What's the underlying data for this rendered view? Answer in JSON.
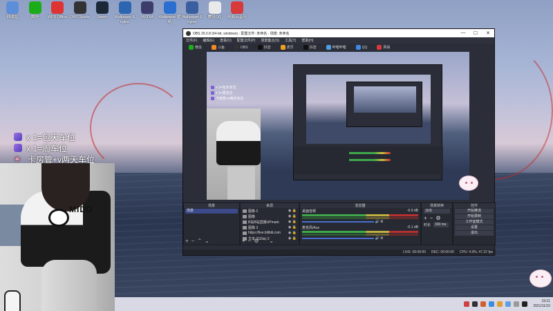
{
  "desktop": {
    "icons": [
      {
        "label": "回收站",
        "color": "#5d8fd8",
        "icon": "recycle-bin-icon"
      },
      {
        "label": "微信",
        "color": "#1aad19",
        "icon": "wechat-icon"
      },
      {
        "label": "WPS Office",
        "color": "#d33",
        "icon": "wps-icon"
      },
      {
        "label": "OBS Studio",
        "color": "#333",
        "icon": "obs-icon"
      },
      {
        "label": "Steam",
        "color": "#1b2838",
        "icon": "steam-icon"
      },
      {
        "label": "Wallpaper Engine",
        "color": "#2c66b0",
        "icon": "wallpaper-icon"
      },
      {
        "label": "NVIDIA",
        "color": "#3d3d6b",
        "icon": "app-icon"
      },
      {
        "label": "Wallpaper 壁纸",
        "color": "#2a6fd0",
        "icon": "wallpaper-icon"
      },
      {
        "label": "Wallpaper Engine",
        "color": "#3a5fa0",
        "icon": "wallpaper-icon"
      },
      {
        "label": "腾讯QQ",
        "color": "#e9e9e9",
        "icon": "qq-icon"
      },
      {
        "label": "网易云音乐",
        "color": "#d63a3a",
        "icon": "music-icon"
      }
    ]
  },
  "overlay": {
    "lines": [
      "x 1=包天车位",
      "x 1=周车位",
      "卡房管+v两天车位"
    ]
  },
  "camera": {
    "sweater_text": "MIDD"
  },
  "obs": {
    "title": "OBS 25.0.8 (64-bit, windows) - 配置文件: 未命名 - 场景: 未命名",
    "controls": {
      "minimize": "—",
      "maximize": "☐",
      "close": "✕"
    },
    "menu": [
      "文件(F)",
      "编辑(E)",
      "查看(V)",
      "配置文件(P)",
      "场景集合(S)",
      "工具(T)",
      "帮助(H)"
    ],
    "toolbar": [
      "微信",
      "斗鱼",
      "OBS",
      "抖音",
      "虎牙",
      "抖音",
      "哔哩哔哩",
      "QQ",
      "网易"
    ],
    "mini_overlay": [
      "x 1=包天车位",
      "x 1=周车位",
      "卡房管+v两天车位"
    ],
    "docks": {
      "scenes": {
        "title": "场景",
        "selected": "场景"
      },
      "sources": {
        "title": "来源",
        "items": [
          "图像 2",
          "图像",
          "B站B站直播UPmark",
          "图像 3",
          "https://live.bilibili.com",
          "文本 (GDI+) 2"
        ]
      },
      "mixer": {
        "title": "混音器",
        "channels": [
          {
            "name": "桌面音频",
            "db": "-6.9 dB"
          },
          {
            "name": "麦克风/Aux",
            "db": "-0.1 dB"
          }
        ]
      },
      "transitions": {
        "title": "场景转换",
        "type": "淡出",
        "duration_label": "时长",
        "duration": "300 ms"
      },
      "controls": {
        "title": "控件",
        "buttons": [
          "开始推流",
          "开始录制",
          "工作室模式",
          "设置",
          "退出"
        ]
      }
    },
    "status": {
      "live": "LIVE: 00:00:00",
      "rec": "REC: 00:00:00",
      "cpu": "CPU: 4.9%, 47.22 fps"
    }
  },
  "taskbar": {
    "time": "19:21",
    "date": "2021/11/10",
    "tray_colors": [
      "#d04040",
      "#333",
      "#d06030",
      "#3a8de0",
      "#e0a030",
      "#60a0e0",
      "#999",
      "#222"
    ]
  }
}
